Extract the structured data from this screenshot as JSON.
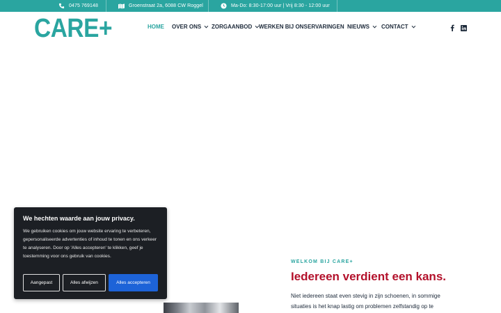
{
  "topbar": {
    "phone": "0475 769148",
    "address": "Groenstraat 2a, 6088 CW Roggel",
    "hours": "Ma-Do: 8:30-17:00 uur | Vrij 8:30 - 12:00 uur",
    "icons": [
      "phone-icon",
      "map-icon",
      "clock-icon"
    ],
    "background": "#2aa5a0"
  },
  "header": {
    "logo": "CARE+",
    "nav": [
      {
        "label": "HOME",
        "active": true,
        "has_dropdown": false
      },
      {
        "label": "OVER ONS",
        "active": false,
        "has_dropdown": true
      },
      {
        "label": "ZORGAANBOD",
        "active": false,
        "has_dropdown": true
      },
      {
        "label": "WERKEN BIJ ONS",
        "active": false,
        "has_dropdown": false
      },
      {
        "label": "ERVARINGEN",
        "active": false,
        "has_dropdown": false
      },
      {
        "label": "NIEUWS",
        "active": false,
        "has_dropdown": true
      },
      {
        "label": "CONTACT",
        "active": false,
        "has_dropdown": true
      }
    ],
    "social": [
      "facebook-icon",
      "linkedin-icon"
    ]
  },
  "intro": {
    "eyebrow": "WELKOM BIJ CARE+",
    "headline": "Iedereen verdient een kans.",
    "body": "Niet iedereen staat even stevig in zijn schoenen, in sommige situaties is het knap lastig om problemen zelfstandig op te"
  },
  "cookie": {
    "title": "We hechten waarde aan jouw privacy.",
    "text": "We gebruiken cookies om jouw website ervaring te verbeteren, gepersonaliseerde advertenties of inhoud te tonen en ons verkeer te analyseren. Door op 'Alles accepteren' te klikken, geef je toestemming voor ons gebruik van cookies.",
    "buttons": {
      "customize": "Aangepast",
      "reject": "Alles afwijzen",
      "accept": "Alles accepteren"
    }
  },
  "colors": {
    "accent": "#2aa5a0",
    "headline": "#b3112b",
    "nav_text": "#1d2a3a",
    "cookie_bg": "#1c1f24",
    "accept_button": "#1d63d8"
  }
}
